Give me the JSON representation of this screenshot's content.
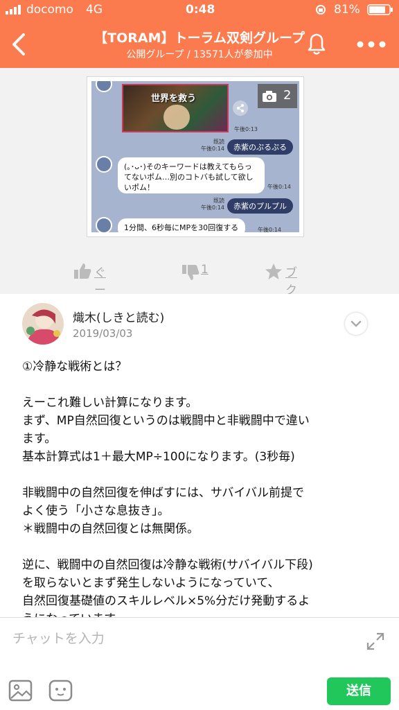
{
  "status_bar": {
    "carrier": "docomo",
    "network": "4G",
    "time": "0:48",
    "battery": "81%"
  },
  "header": {
    "title": "【TORAM】トーラム双剣グループ",
    "subtitle": "公開グループ / 13571人が参加中",
    "back_icon": "chevron-left-icon",
    "bell_icon": "bell-icon",
    "more_icon": "more-dots-icon",
    "background_color": "#fb7a4e"
  },
  "attachment": {
    "photo_count": "2",
    "messages": [
      {
        "side": "meta",
        "time": "午後0:13"
      },
      {
        "side": "right",
        "read": "既読",
        "time": "午後0:14",
        "text": "赤紫のぷるぷる"
      },
      {
        "side": "left",
        "text": "(｡･ᴗ･)そのキーワードは教えてもらってないポム…別のコトバも試して欲しいポム！",
        "time": "午後0:14"
      },
      {
        "side": "right",
        "read": "既読",
        "time": "午後0:14",
        "text": "赤紫のプルプル"
      },
      {
        "side": "left",
        "text": "1分間、6秒毎にMPを30回復する",
        "time": "午後0:14"
      }
    ],
    "banner_text": "世界を救う"
  },
  "actions": {
    "like_label": "ぐー",
    "dislike_count": "1",
    "bookmark_label": "ブクマ"
  },
  "comment": {
    "author": "熾木(しきと読む)",
    "date": "2019/03/03",
    "lines": [
      "①冷静な戦術とは？",
      "",
      "えーこれ難しい計算になります。",
      "まず、MP自然回復というのは戦闘中と非戦闘中で違い",
      "ます。",
      "基本計算式は1＋最大MP÷100になります。(3秒毎)",
      "",
      "非戦闘中の自然回復を伸ばすには、サバイバル前提で",
      "よく使う「小さな息抜き」。",
      "＊戦闘中の自然回復とは無関係。",
      "",
      "逆に、戦闘中の自然回復は冷静な戦術(サバイバル下段)",
      "を取らないとまず発生しないようになっていて、",
      "自然回復基礎値のスキルレベル×5%分だけ発動するよ",
      "うになっています。"
    ]
  },
  "input": {
    "placeholder": "チャットを入力",
    "send_label": "送信",
    "send_color": "#21c75a"
  }
}
